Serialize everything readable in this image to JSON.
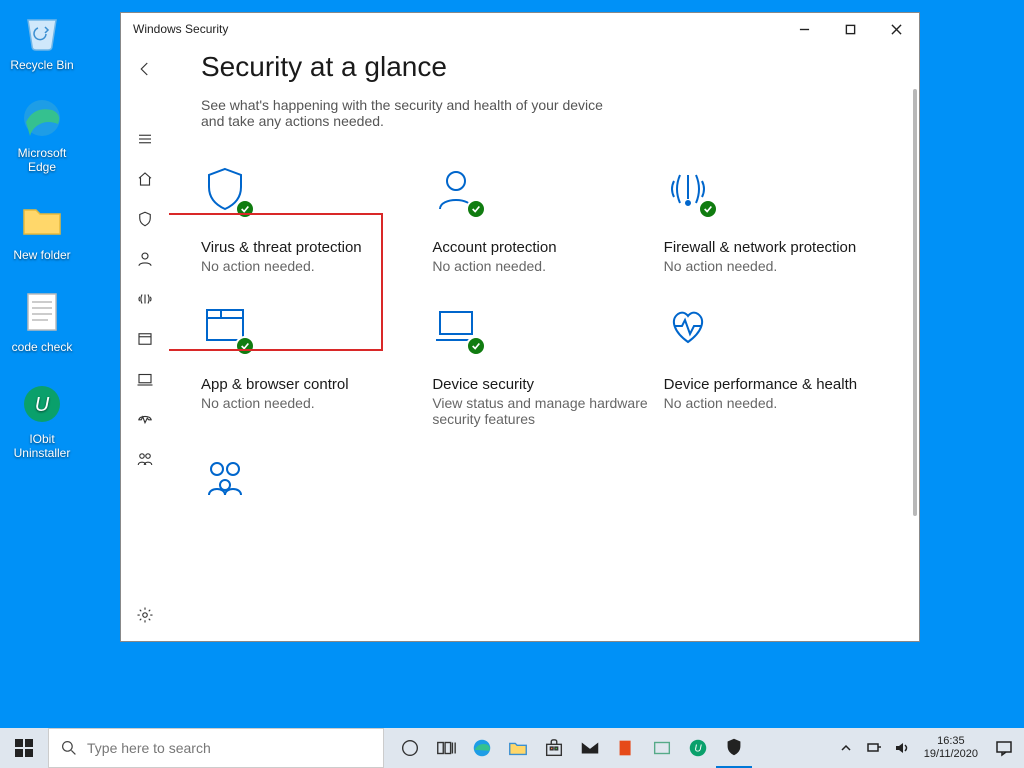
{
  "desktop_icons": [
    {
      "label": "Recycle Bin"
    },
    {
      "label": "Microsoft Edge"
    },
    {
      "label": "New folder"
    },
    {
      "label": "code check"
    },
    {
      "label": "IObit Uninstaller"
    }
  ],
  "window": {
    "title": "Windows Security",
    "heading": "Security at a glance",
    "subtitle": "See what's happening with the security and health of your device and take any actions needed."
  },
  "tiles": [
    {
      "title": "Virus & threat protection",
      "sub": "No action needed."
    },
    {
      "title": "Account protection",
      "sub": "No action needed."
    },
    {
      "title": "Firewall & network protection",
      "sub": "No action needed."
    },
    {
      "title": "App & browser control",
      "sub": "No action needed."
    },
    {
      "title": "Device security",
      "sub": "View status and manage hardware security features"
    },
    {
      "title": "Device performance & health",
      "sub": "No action needed."
    }
  ],
  "taskbar": {
    "search_placeholder": "Type here to search",
    "clock_time": "16:35",
    "clock_date": "19/11/2020"
  }
}
